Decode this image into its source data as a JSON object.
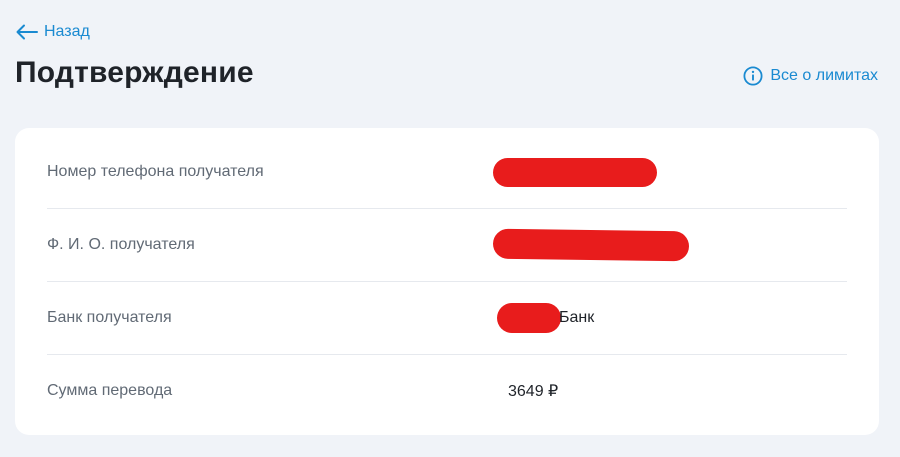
{
  "nav": {
    "back_label": "Назад"
  },
  "header": {
    "title": "Подтверждение",
    "limits_label": "Все о лимитах"
  },
  "details": [
    {
      "label": "Номер телефона получателя",
      "value": "",
      "redacted": true
    },
    {
      "label": "Ф. И. О. получателя",
      "value": "",
      "redacted": true
    },
    {
      "label": "Банк получателя",
      "value": "Банк",
      "redacted": true
    },
    {
      "label": "Сумма перевода",
      "value": "3649 ₽",
      "redacted": false
    }
  ],
  "colors": {
    "background": "#f0f3f8",
    "card": "#ffffff",
    "accent": "#1a8ad1",
    "redaction": "#e81c1c",
    "label_text": "#616a75",
    "primary_text": "#1f2329"
  },
  "icons": {
    "back": "arrow-left-icon",
    "limits": "info-icon"
  }
}
